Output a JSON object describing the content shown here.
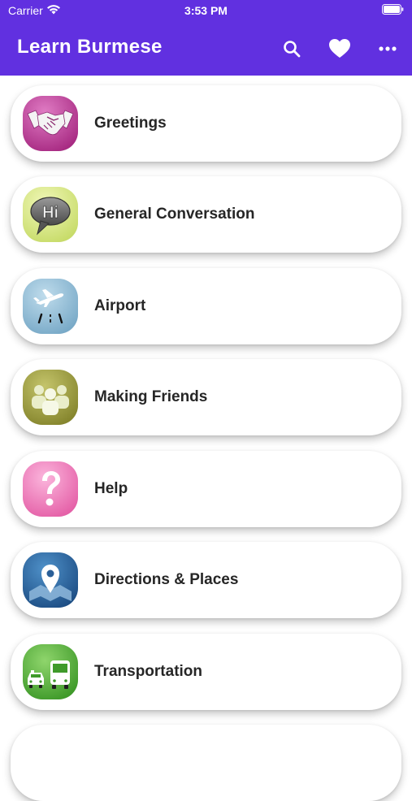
{
  "status": {
    "carrier": "Carrier",
    "time": "3:53 PM"
  },
  "app": {
    "title": "Learn Burmese",
    "bar_color": "#6130e0"
  },
  "nav_icons": [
    "search-icon",
    "heart-icon",
    "more-icon"
  ],
  "categories": [
    {
      "label": "Greetings",
      "icon": "handshake-icon",
      "color": "#c2439c"
    },
    {
      "label": "General Conversation",
      "icon": "speech-bubble-icon",
      "icon_text": "Hi",
      "color": "#dcea8e"
    },
    {
      "label": "Airport",
      "icon": "airplane-icon",
      "color": "#8dbdd6"
    },
    {
      "label": "Making Friends",
      "icon": "people-icon",
      "color": "#a3a44a"
    },
    {
      "label": "Help",
      "icon": "question-mark-icon",
      "color": "#f080bd"
    },
    {
      "label": "Directions & Places",
      "icon": "map-pin-icon",
      "color": "#2f6fae"
    },
    {
      "label": "Transportation",
      "icon": "taxi-bus-icon",
      "color": "#64b743"
    }
  ]
}
